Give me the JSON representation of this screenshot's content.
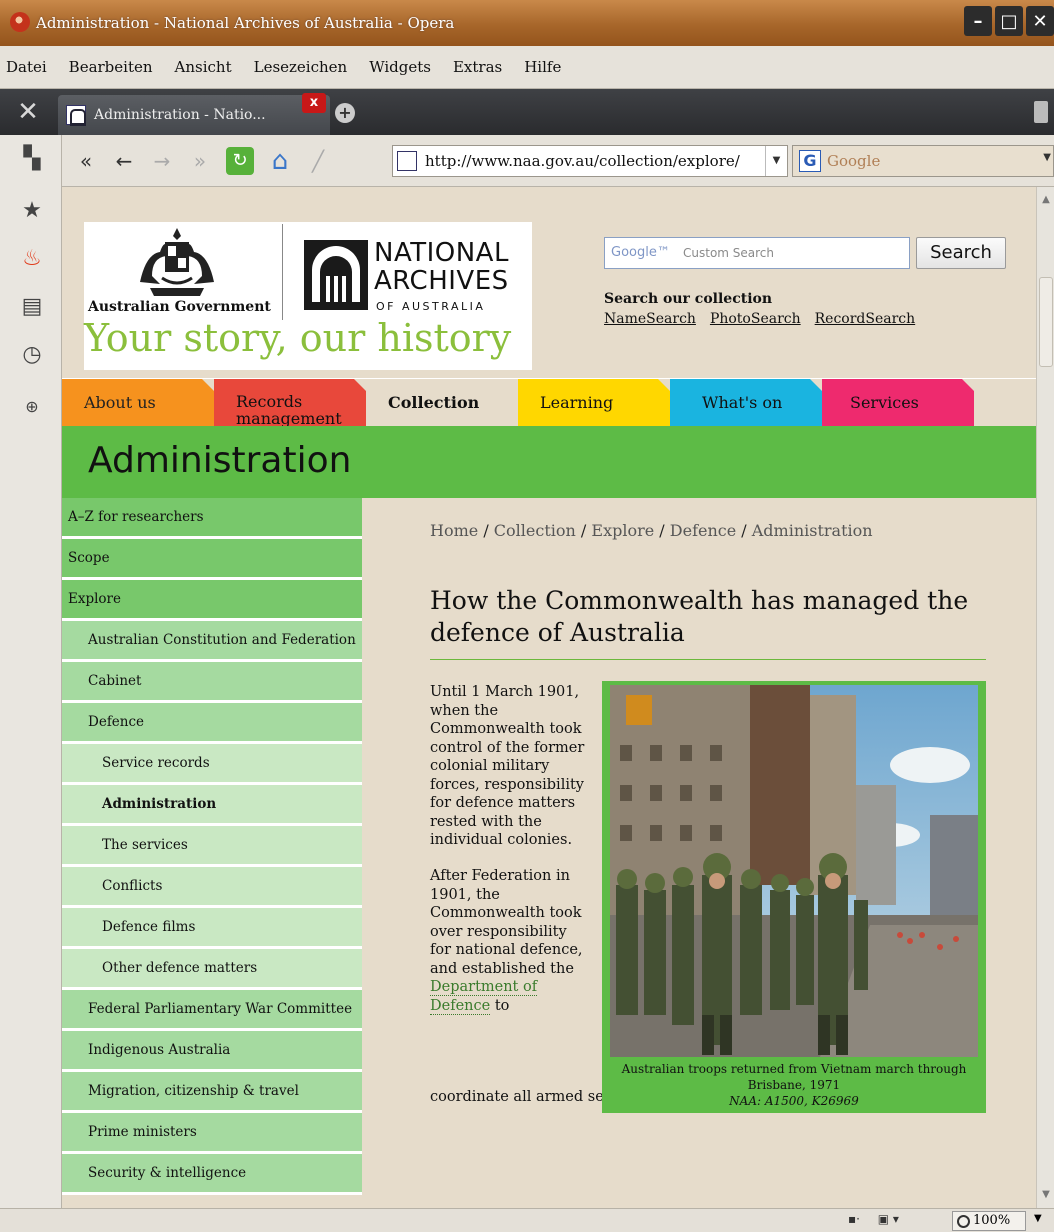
{
  "window": {
    "title": "Administration - National Archives of Australia - Opera",
    "controls": [
      "minimize",
      "maximize",
      "close"
    ]
  },
  "menu": [
    "Datei",
    "Bearbeiten",
    "Ansicht",
    "Lesezeichen",
    "Widgets",
    "Extras",
    "Hilfe"
  ],
  "tab": {
    "label": "Administration - Natio...",
    "close_label": "x",
    "new_tab_label": "+"
  },
  "toolbar": {
    "address": "http://www.naa.gov.au/collection/explore/",
    "search_placeholder": "Google",
    "search_engine_icon": "G"
  },
  "page": {
    "gov_label": "Australian Government",
    "naa_line1": "NATIONAL",
    "naa_line2": "ARCHIVES",
    "naa_line3": "OF AUSTRALIA",
    "tagline": "Your story, our history",
    "search": {
      "brand": "Google™",
      "placeholder": "Custom Search",
      "button": "Search"
    },
    "collection_heading": "Search our collection",
    "collection_links": [
      "NameSearch",
      "PhotoSearch",
      "RecordSearch"
    ],
    "nav_tabs": [
      "About us",
      "Records management",
      "Collection",
      "Learning",
      "What's on",
      "Services"
    ],
    "banner_title": "Administration",
    "sidebar": [
      {
        "label": "A–Z for researchers",
        "level": 1
      },
      {
        "label": "Scope",
        "level": 1
      },
      {
        "label": "Explore",
        "level": 1
      },
      {
        "label": "Australian Constitution and Federation",
        "level": 2
      },
      {
        "label": "Cabinet",
        "level": 2
      },
      {
        "label": "Defence",
        "level": 2
      },
      {
        "label": "Service records",
        "level": 3
      },
      {
        "label": "Administration",
        "level": 3,
        "active": true
      },
      {
        "label": "The services",
        "level": 3
      },
      {
        "label": "Conflicts",
        "level": 3
      },
      {
        "label": "Defence films",
        "level": 3
      },
      {
        "label": "Other defence matters",
        "level": 3
      },
      {
        "label": "Federal Parliamentary War Committee",
        "level": 2
      },
      {
        "label": "Indigenous Australia",
        "level": 2
      },
      {
        "label": "Migration, citizenship & travel",
        "level": 2
      },
      {
        "label": "Prime ministers",
        "level": 2
      },
      {
        "label": "Security & intelligence",
        "level": 2
      }
    ],
    "breadcrumb": [
      "Home",
      "Collection",
      "Explore",
      "Defence",
      "Administration"
    ],
    "heading": "How the Commonwealth has managed the defence of Australia",
    "para1": "Until 1 March 1901, when the Commonwealth took control of the former colonial military forces, responsibility for defence matters rested with the individual colonies.",
    "para2_before": "After Federation in 1901, the Commonwealth took over responsibility for national defence, and established the",
    "para2_link": "Department of Defence",
    "para2_after": "to",
    "para2_continued": "coordinate all armed services. Initially, it was mainly responsible for",
    "caption_line1": "Australian troops returned from Vietnam march through Brisbane, 1971",
    "caption_line2": "NAA: A1500, K26969"
  },
  "status": {
    "zoom": "100%"
  },
  "colors": {
    "tab_about": "#f6921e",
    "tab_records": "#e8483b",
    "tab_learning": "#ffd700",
    "tab_whatson": "#1ab4e0",
    "tab_services": "#ee2a6e",
    "banner_green": "#5dbb46",
    "page_bg": "#e6dccb"
  }
}
